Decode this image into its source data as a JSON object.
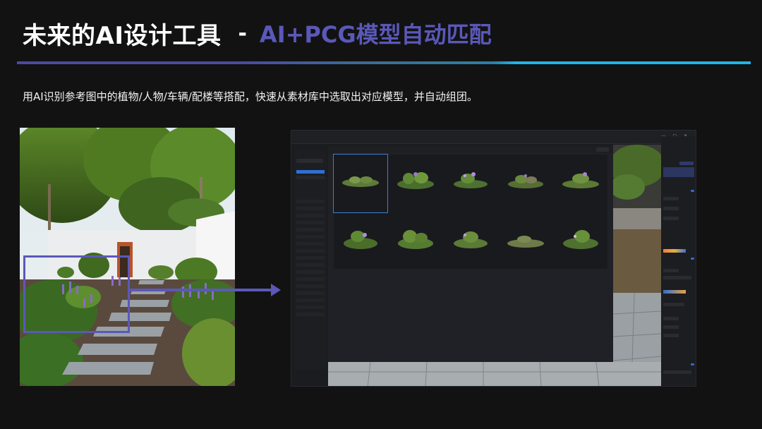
{
  "header": {
    "title": "未来的AI设计工具",
    "separator": "-",
    "subtitle": "AI+PCG模型自动匹配"
  },
  "description": "用AI识别参考图中的植物/人物/车辆/配楼等搭配，快速从素材库中选取出对应模型，并自动组团。",
  "colors": {
    "accent_purple": "#5a58b8",
    "accent_cyan": "#1fb4e8",
    "background": "#121212"
  },
  "icons": {
    "arrow": "arrow-right-icon"
  }
}
